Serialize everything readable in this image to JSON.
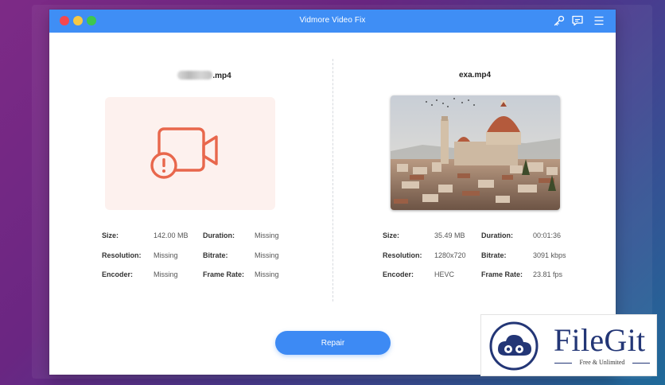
{
  "window": {
    "title": "Vidmore Video Fix",
    "icons": [
      "key-icon",
      "feedback-icon",
      "menu-icon"
    ]
  },
  "left_panel": {
    "filename_ext": ".mp4",
    "status_icon": "broken-video-icon",
    "accent_color": "#e8674c",
    "fields": [
      {
        "label": "Size:",
        "value": "142.00 MB"
      },
      {
        "label": "Duration:",
        "value": "Missing"
      },
      {
        "label": "Resolution:",
        "value": "Missing"
      },
      {
        "label": "Bitrate:",
        "value": "Missing"
      },
      {
        "label": "Encoder:",
        "value": "Missing"
      },
      {
        "label": "Frame Rate:",
        "value": "Missing"
      }
    ]
  },
  "right_panel": {
    "filename": "exa.mp4",
    "fields": [
      {
        "label": "Size:",
        "value": "35.49 MB"
      },
      {
        "label": "Duration:",
        "value": "00:01:36"
      },
      {
        "label": "Resolution:",
        "value": "1280x720"
      },
      {
        "label": "Bitrate:",
        "value": "3091 kbps"
      },
      {
        "label": "Encoder:",
        "value": "HEVC"
      },
      {
        "label": "Frame Rate:",
        "value": "23.81 fps"
      }
    ]
  },
  "actions": {
    "repair_label": "Repair"
  },
  "watermark": {
    "brand": "FileGit",
    "tagline": "Free & Unlimited"
  },
  "colors": {
    "titlebar": "#3f8ef5",
    "button": "#3d8af4"
  }
}
